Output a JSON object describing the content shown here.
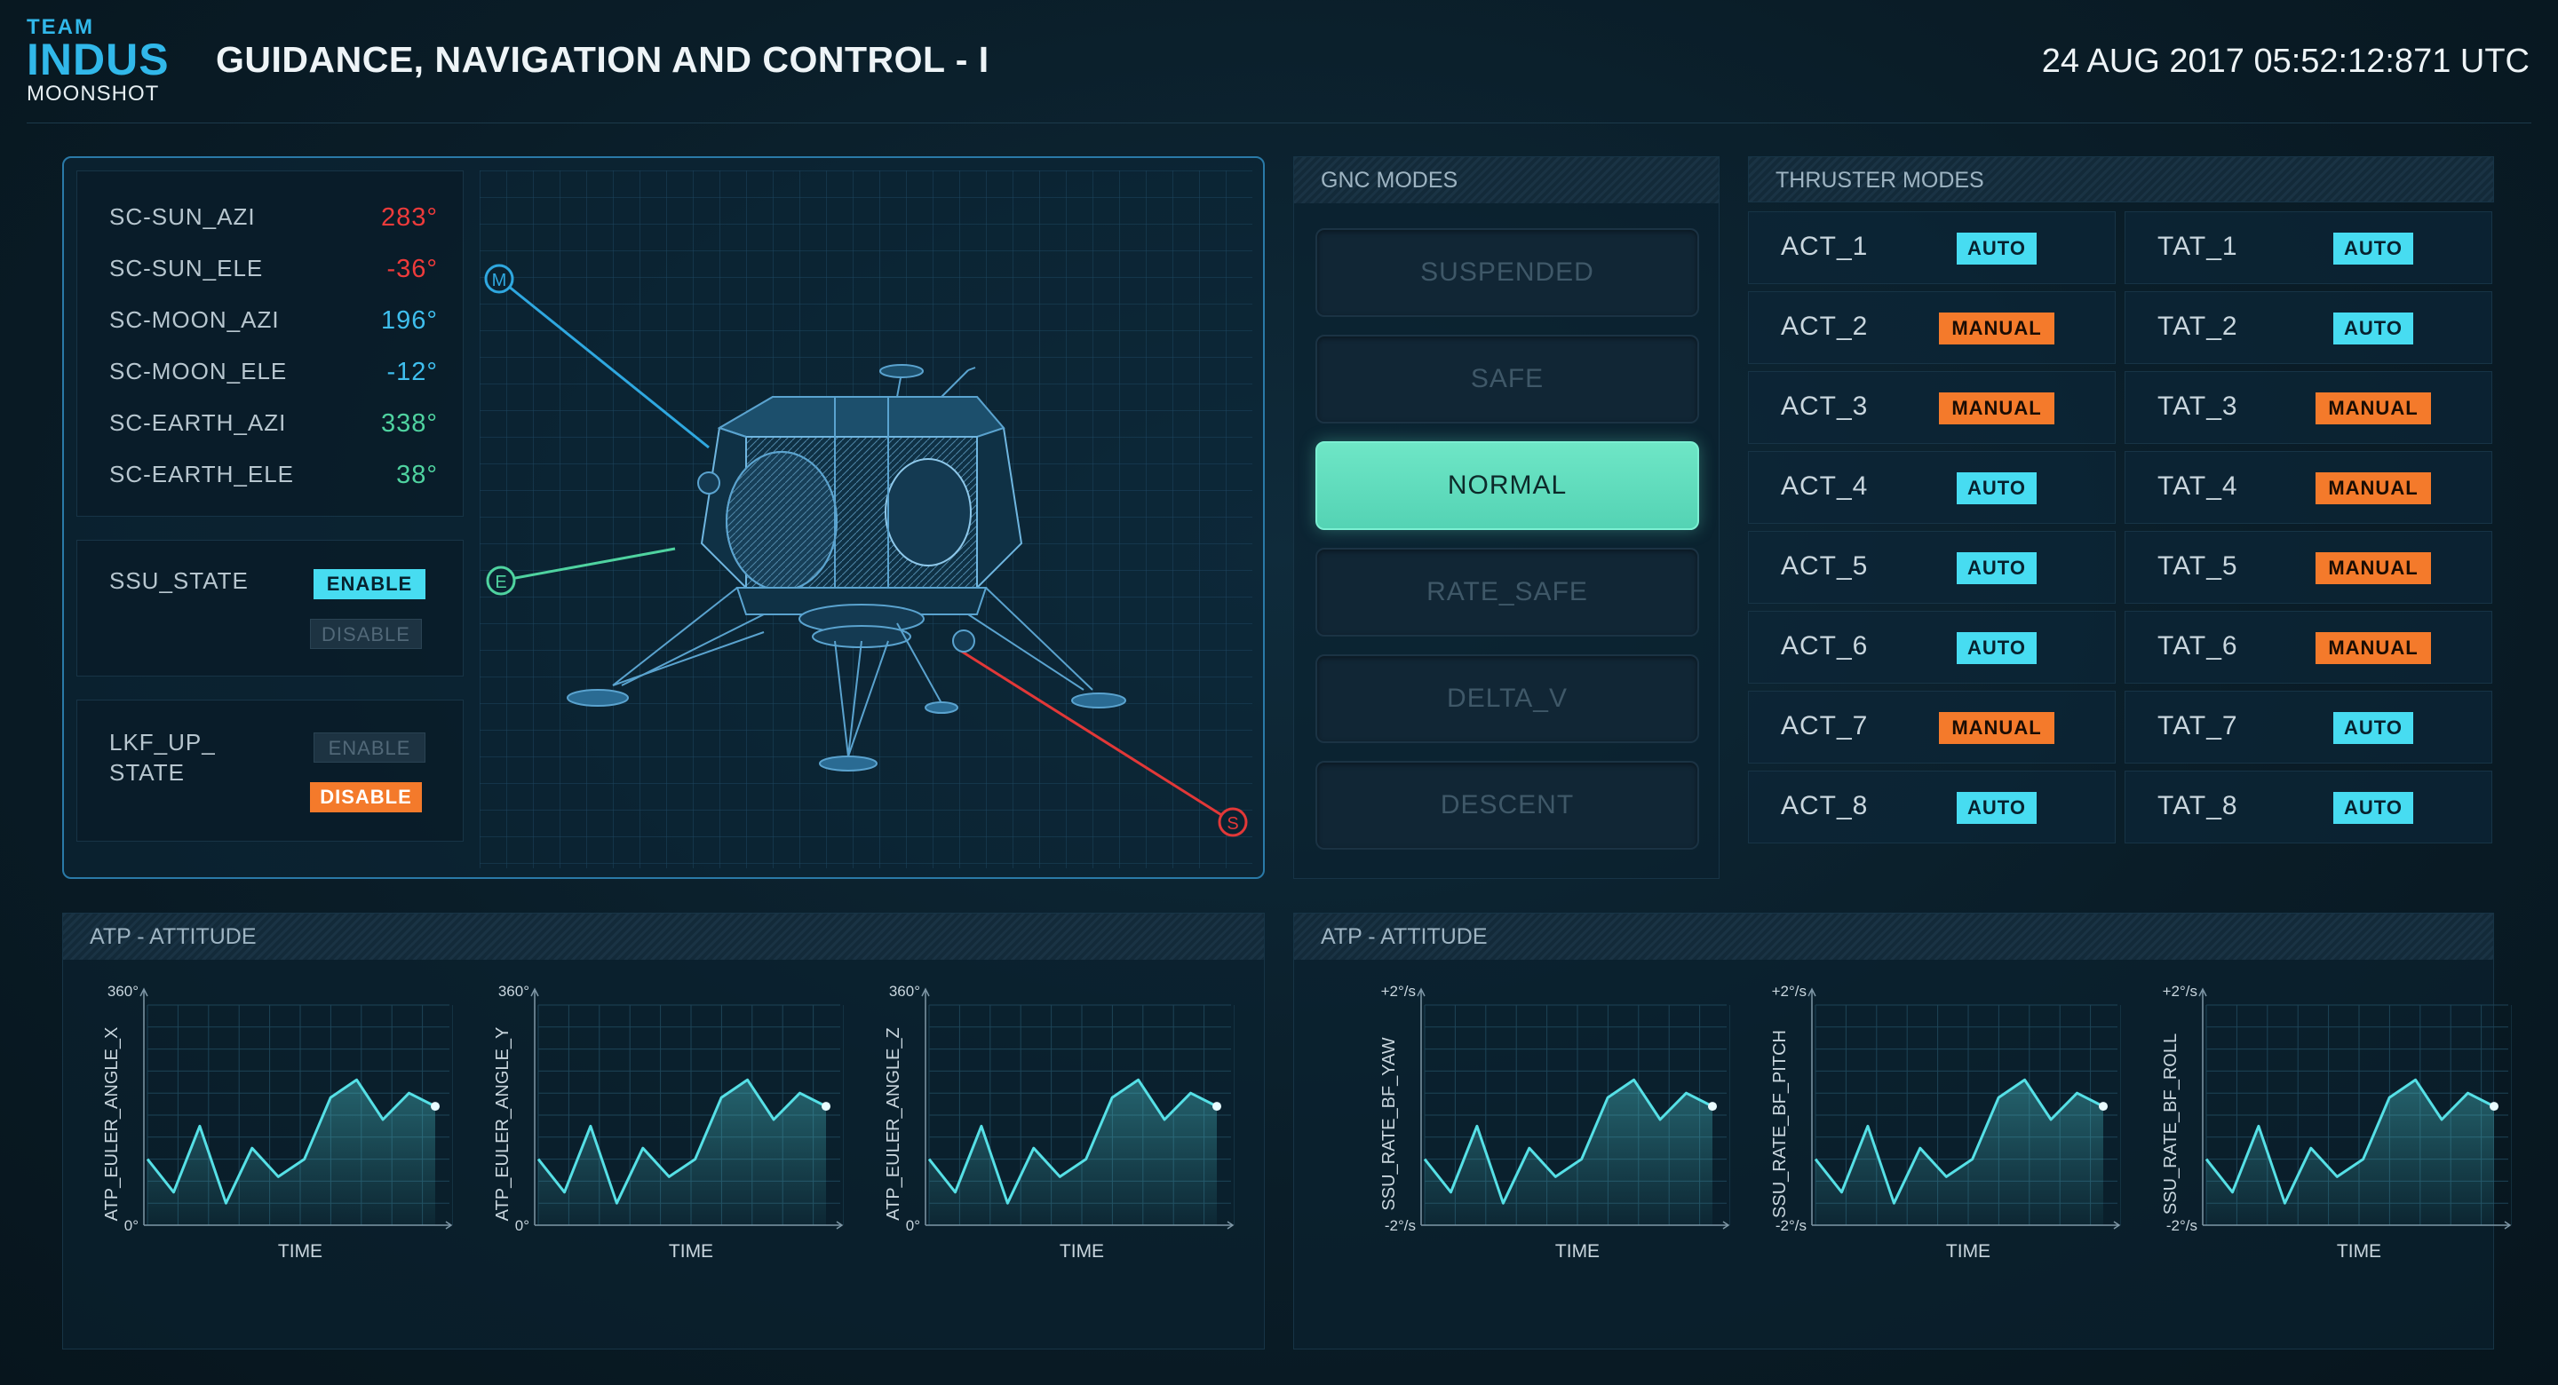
{
  "header": {
    "logo_team": "TEAM",
    "logo_indus": "INDUS",
    "logo_moonshot": "MOONSHOT",
    "title": "GUIDANCE, NAVIGATION AND CONTROL - I",
    "timestamp": "24 AUG 2017 05:52:12:871 UTC"
  },
  "sensors": [
    {
      "label": "SC-SUN_AZI",
      "value": "283°",
      "color": "#ee3b3b"
    },
    {
      "label": "SC-SUN_ELE",
      "value": "-36°",
      "color": "#ee3b3b"
    },
    {
      "label": "SC-MOON_AZI",
      "value": "196°",
      "color": "#3fbfee"
    },
    {
      "label": "SC-MOON_ELE",
      "value": "-12°",
      "color": "#3fbfee"
    },
    {
      "label": "SC-EARTH_AZI",
      "value": "338°",
      "color": "#4fd3a0"
    },
    {
      "label": "SC-EARTH_ELE",
      "value": "38°",
      "color": "#4fd3a0"
    }
  ],
  "ssu_state": {
    "label": "SSU_STATE",
    "enable": "ENABLE",
    "disable": "DISABLE",
    "selected": "enable"
  },
  "lkf_state": {
    "label_line1": "LKF_UP_",
    "label_line2": "STATE",
    "enable": "ENABLE",
    "disable": "DISABLE",
    "selected": "disable"
  },
  "lander_markers": {
    "moon": "M",
    "earth": "E",
    "sun": "S"
  },
  "gnc": {
    "title": "GNC MODES",
    "modes": [
      "SUSPENDED",
      "SAFE",
      "NORMAL",
      "RATE_SAFE",
      "DELTA_V",
      "DESCENT"
    ],
    "active": "NORMAL"
  },
  "thrusters": {
    "title": "THRUSTER MODES",
    "act": [
      {
        "name": "ACT_1",
        "mode": "AUTO"
      },
      {
        "name": "ACT_2",
        "mode": "MANUAL"
      },
      {
        "name": "ACT_3",
        "mode": "MANUAL"
      },
      {
        "name": "ACT_4",
        "mode": "AUTO"
      },
      {
        "name": "ACT_5",
        "mode": "AUTO"
      },
      {
        "name": "ACT_6",
        "mode": "AUTO"
      },
      {
        "name": "ACT_7",
        "mode": "MANUAL"
      },
      {
        "name": "ACT_8",
        "mode": "AUTO"
      }
    ],
    "tat": [
      {
        "name": "TAT_1",
        "mode": "AUTO"
      },
      {
        "name": "TAT_2",
        "mode": "AUTO"
      },
      {
        "name": "TAT_3",
        "mode": "MANUAL"
      },
      {
        "name": "TAT_4",
        "mode": "MANUAL"
      },
      {
        "name": "TAT_5",
        "mode": "MANUAL"
      },
      {
        "name": "TAT_6",
        "mode": "MANUAL"
      },
      {
        "name": "TAT_7",
        "mode": "AUTO"
      },
      {
        "name": "TAT_8",
        "mode": "AUTO"
      }
    ]
  },
  "chart_panels": [
    {
      "title": "ATP - ATTITUDE"
    },
    {
      "title": "ATP - ATTITUDE"
    }
  ],
  "chart_data": [
    {
      "type": "area",
      "ylabel": "ATP_EULER_ANGLE_X",
      "xlabel": "TIME",
      "ytop": "360°",
      "ybottom": "0°",
      "x": [
        0,
        1,
        2,
        3,
        4,
        5,
        6,
        7,
        8,
        9,
        10,
        11
      ],
      "values": [
        30,
        15,
        45,
        10,
        35,
        22,
        30,
        58,
        66,
        48,
        60,
        54
      ]
    },
    {
      "type": "area",
      "ylabel": "ATP_EULER_ANGLE_Y",
      "xlabel": "TIME",
      "ytop": "360°",
      "ybottom": "0°",
      "x": [
        0,
        1,
        2,
        3,
        4,
        5,
        6,
        7,
        8,
        9,
        10,
        11
      ],
      "values": [
        30,
        15,
        45,
        10,
        35,
        22,
        30,
        58,
        66,
        48,
        60,
        54
      ]
    },
    {
      "type": "area",
      "ylabel": "ATP_EULER_ANGLE_Z",
      "xlabel": "TIME",
      "ytop": "360°",
      "ybottom": "0°",
      "x": [
        0,
        1,
        2,
        3,
        4,
        5,
        6,
        7,
        8,
        9,
        10,
        11
      ],
      "values": [
        30,
        15,
        45,
        10,
        35,
        22,
        30,
        58,
        66,
        48,
        60,
        54
      ]
    },
    {
      "type": "area",
      "ylabel": "SSU_RATE_BF_YAW",
      "xlabel": "TIME",
      "ytop": "+2°/s",
      "ybottom": "-2°/s",
      "x": [
        0,
        1,
        2,
        3,
        4,
        5,
        6,
        7,
        8,
        9,
        10,
        11
      ],
      "values": [
        30,
        15,
        45,
        10,
        35,
        22,
        30,
        58,
        66,
        48,
        60,
        54
      ]
    },
    {
      "type": "area",
      "ylabel": "SSU_RATE_BF_PITCH",
      "xlabel": "TIME",
      "ytop": "+2°/s",
      "ybottom": "-2°/s",
      "x": [
        0,
        1,
        2,
        3,
        4,
        5,
        6,
        7,
        8,
        9,
        10,
        11
      ],
      "values": [
        30,
        15,
        45,
        10,
        35,
        22,
        30,
        58,
        66,
        48,
        60,
        54
      ]
    },
    {
      "type": "area",
      "ylabel": "SSU_RATE_BF_ROLL",
      "xlabel": "TIME",
      "ytop": "+2°/s",
      "ybottom": "-2°/s",
      "x": [
        0,
        1,
        2,
        3,
        4,
        5,
        6,
        7,
        8,
        9,
        10,
        11
      ],
      "values": [
        30,
        15,
        45,
        10,
        35,
        22,
        30,
        58,
        66,
        48,
        60,
        54
      ]
    }
  ],
  "colors": {
    "accent_cyan": "#47dcf1",
    "accent_orange": "#f47a2b",
    "active_mode": "#5ddbbb",
    "chart_line": "#56e0e6",
    "sun_line": "#e23838",
    "moon_line": "#2fa8e0",
    "earth_line": "#4fd3a0"
  }
}
